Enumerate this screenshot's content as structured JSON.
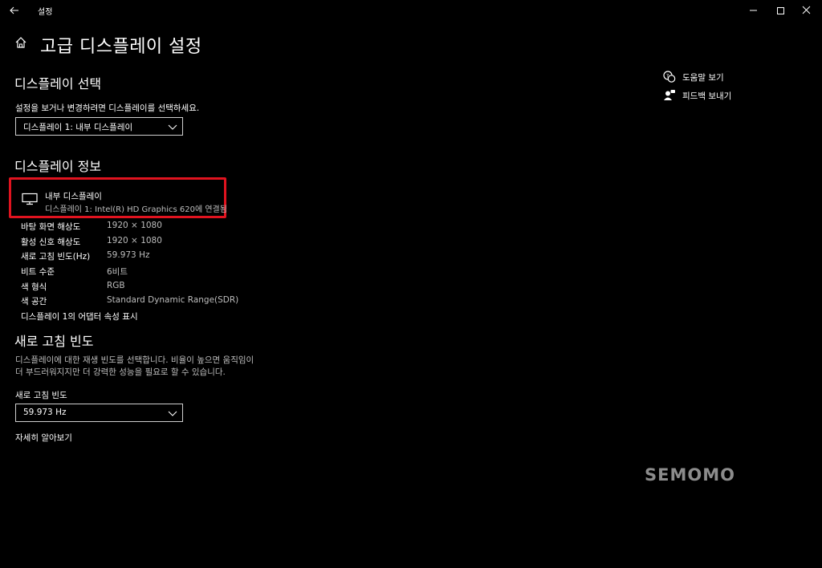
{
  "window": {
    "title": "설정"
  },
  "page": {
    "title": "고급 디스플레이 설정"
  },
  "display_select": {
    "heading": "디스플레이 선택",
    "description": "설정을 보거나 변경하려면 디스플레이를 선택하세요.",
    "selected": "디스플레이 1: 내부 디스플레이"
  },
  "display_info": {
    "heading": "디스플레이 정보",
    "name": "내부 디스플레이",
    "connection": "디스플레이 1: Intel(R) HD Graphics 620에 연결됨",
    "rows": [
      {
        "key": "바탕 화면 해상도",
        "value": "1920 × 1080"
      },
      {
        "key": "활성 신호 해상도",
        "value": "1920 × 1080"
      },
      {
        "key": "새로 고침 빈도(Hz)",
        "value": "59.973 Hz"
      },
      {
        "key": "비트 수준",
        "value": "6비트"
      },
      {
        "key": "색 형식",
        "value": "RGB"
      },
      {
        "key": "색 공간",
        "value": "Standard Dynamic Range(SDR)"
      }
    ],
    "adapter_link": "디스플레이 1의 어댑터 속성 표시"
  },
  "refresh": {
    "heading": "새로 고침 빈도",
    "description_line1": "디스플레이에 대한 재생 빈도를 선택합니다. 비율이 높으면 움직임이",
    "description_line2": "더 부드러워지지만 더 강력한 성능을 필요로 할 수 있습니다.",
    "label": "새로 고침 빈도",
    "selected": "59.973 Hz",
    "learn_more": "자세히 알아보기"
  },
  "sidebar": {
    "help": "도움말 보기",
    "feedback": "피드백 보내기"
  },
  "watermark": "SEMOMO"
}
